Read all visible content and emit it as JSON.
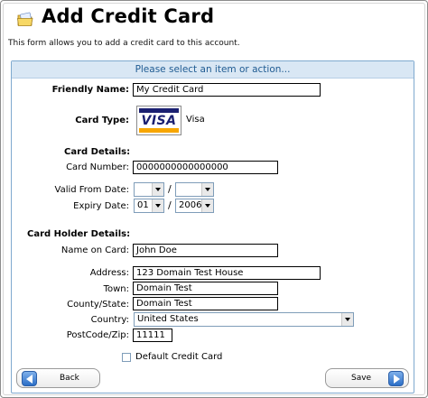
{
  "page": {
    "title": "Add Credit Card",
    "intro": "This form allows you to add a credit card to this account."
  },
  "panel": {
    "header": "Please select an item or action..."
  },
  "form": {
    "friendly_name": {
      "label": "Friendly Name:",
      "value": "My Credit Card"
    },
    "card_type": {
      "label": "Card Type:",
      "logo_text": "VISA",
      "name": "Visa"
    },
    "card_details_heading": "Card Details:",
    "card_number": {
      "label": "Card Number:",
      "value": "0000000000000000"
    },
    "valid_from": {
      "label": "Valid From Date:",
      "month": "",
      "year": "",
      "separator": "/"
    },
    "expiry": {
      "label": "Expiry Date:",
      "month": "01",
      "year": "2006",
      "separator": "/"
    },
    "holder_heading": "Card Holder Details:",
    "name_on_card": {
      "label": "Name on Card:",
      "value": "John Doe"
    },
    "address": {
      "label": "Address:",
      "value": "123 Domain Test House"
    },
    "town": {
      "label": "Town:",
      "value": "Domain Test"
    },
    "county": {
      "label": "County/State:",
      "value": "Domain Test"
    },
    "country": {
      "label": "Country:",
      "value": "United States"
    },
    "postcode": {
      "label": "PostCode/Zip:",
      "value": "11111"
    },
    "default_card": {
      "label": "Default Credit Card",
      "checked": false
    }
  },
  "buttons": {
    "back": "Back",
    "save": "Save"
  },
  "colors": {
    "panel_header_bg": "#d9e7f4",
    "panel_header_text": "#1f5b92",
    "panel_border": "#7fa9cf",
    "button_icon": "#2c6fc7"
  },
  "icons": {
    "title": "folder-card-icon",
    "back": "arrow-left-icon",
    "save": "arrow-right-icon"
  }
}
